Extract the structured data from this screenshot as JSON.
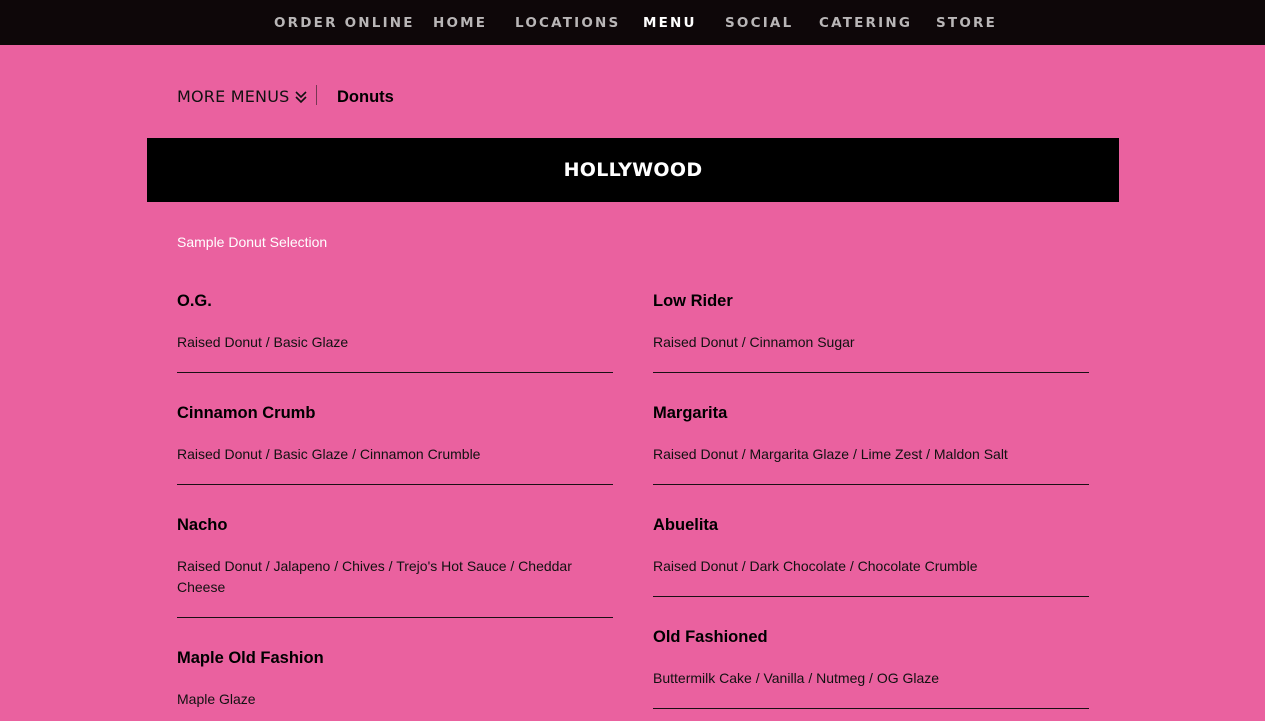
{
  "nav": {
    "items": [
      {
        "label": "ORDER ONLINE",
        "active": false
      },
      {
        "label": "HOME",
        "active": false
      },
      {
        "label": "LOCATIONS",
        "active": false
      },
      {
        "label": "MENU",
        "active": true
      },
      {
        "label": "SOCIAL",
        "active": false
      },
      {
        "label": "CATERING",
        "active": false
      },
      {
        "label": "STORE",
        "active": false
      }
    ]
  },
  "submenu": {
    "more_menus_label": "MORE MENUS",
    "more_menus_icon": "double-chevron-down-icon",
    "current_menu": "Donuts"
  },
  "location": {
    "name": "HOLLYWOOD"
  },
  "section": {
    "title": "Sample Donut Selection"
  },
  "menu_items": {
    "left": [
      {
        "name": "O.G.",
        "description": "Raised Donut / Basic Glaze"
      },
      {
        "name": "Cinnamon Crumb",
        "description": "Raised Donut / Basic Glaze / Cinnamon Crumble"
      },
      {
        "name": "Nacho",
        "description": "Raised Donut / Jalapeno / Chives / Trejo's Hot Sauce / Cheddar Cheese"
      },
      {
        "name": "Maple Old Fashion",
        "description": "Maple Glaze"
      }
    ],
    "right": [
      {
        "name": "Low Rider",
        "description": "Raised Donut / Cinnamon Sugar"
      },
      {
        "name": "Margarita",
        "description": "Raised Donut / Margarita Glaze / Lime Zest / Maldon Salt"
      },
      {
        "name": "Abuelita",
        "description": "Raised Donut / Dark Chocolate / Chocolate Crumble"
      },
      {
        "name": "Old Fashioned",
        "description": "Buttermilk Cake / Vanilla / Nutmeg / OG Glaze"
      }
    ]
  },
  "colors": {
    "background": "#ea619f",
    "nav_background": "#0e0709",
    "nav_text": "#b9b6b7",
    "nav_active": "#ffffff",
    "banner_background": "#000000"
  }
}
